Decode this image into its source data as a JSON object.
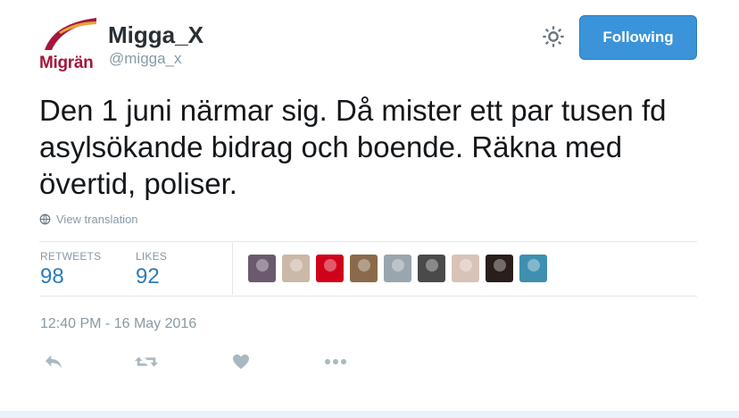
{
  "account": {
    "display_name": "Migga_X",
    "screen_name": "@migga_x",
    "avatar_text": "Migrän"
  },
  "header": {
    "follow_label": "Following",
    "settings_icon": "gear-icon"
  },
  "tweet": {
    "text": "Den 1 juni närmar sig. Då mister ett par tusen fd asylsökande bidrag och boende. Räkna med övertid, poliser.",
    "translate_label": "View translation"
  },
  "stats": {
    "retweets_label": "RETWEETS",
    "retweets_value": "98",
    "likes_label": "LIKES",
    "likes_value": "92"
  },
  "likers": [
    {
      "icon": "user-avatar",
      "color": "#6b5a6e"
    },
    {
      "icon": "user-avatar",
      "color": "#cbb8a6"
    },
    {
      "icon": "user-avatar",
      "color": "#d0021b"
    },
    {
      "icon": "user-avatar",
      "color": "#8a6a4a"
    },
    {
      "icon": "user-avatar",
      "color": "#9aa5ad"
    },
    {
      "icon": "user-avatar",
      "color": "#4a4a4a"
    },
    {
      "icon": "user-avatar",
      "color": "#d9c3b8"
    },
    {
      "icon": "user-avatar",
      "color": "#2a1e1a"
    },
    {
      "icon": "user-avatar",
      "color": "#3f8fb0"
    }
  ],
  "timestamp": "12:40 PM - 16 May 2016",
  "actions": [
    "reply-icon",
    "retweet-icon",
    "like-icon",
    "more-icon"
  ],
  "colors": {
    "brand_red": "#a5173a",
    "brand_gold": "#e8a33a",
    "follow_blue": "#3b94d9",
    "link_blue": "#2b7bb9",
    "muted": "#8899a6"
  }
}
